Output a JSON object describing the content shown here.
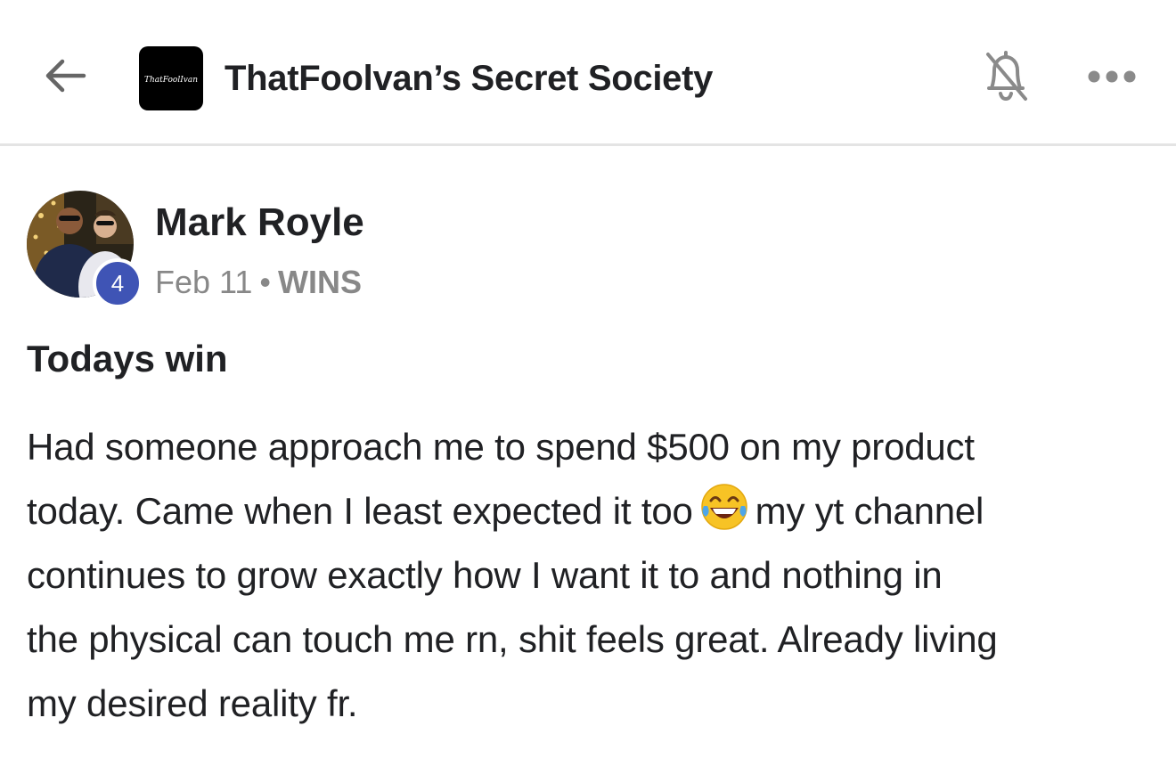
{
  "header": {
    "back_icon": "arrow-left-icon",
    "group_logo_text": "ThatFoolIvan",
    "group_name": "ThatFoolvan’s Secret Society",
    "notification_icon": "bell-off-icon",
    "more_icon": "more-horizontal-icon"
  },
  "post": {
    "author": {
      "name": "Mark Royle",
      "level": "4",
      "level_badge_color": "#3f54b5"
    },
    "date": "Feb 11",
    "separator": "•",
    "category": "WINS",
    "title": "Todays win",
    "body_lines": [
      {
        "text": "Had someone approach me to spend $500 on my product"
      },
      {
        "before": "today. Came when I least expected it too",
        "emoji": "face-with-tears-of-joy",
        "after": "my yt channel"
      },
      {
        "text": "continues to grow exactly how I want it to and nothing in"
      },
      {
        "text": "the physical can touch me rn, shit feels great. Already living"
      },
      {
        "text": "my desired reality fr."
      }
    ]
  }
}
